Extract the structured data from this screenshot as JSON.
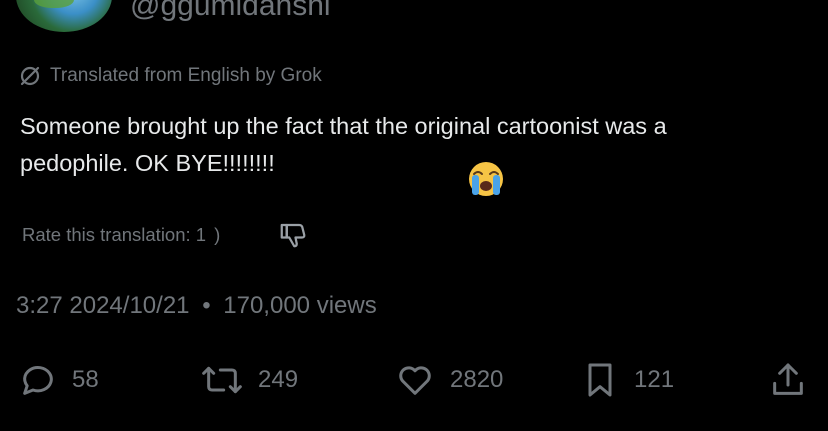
{
  "author": {
    "handle": "@ggumidanshi"
  },
  "translation": {
    "notice": "Translated from English by Grok",
    "rate_label": "Rate this translation: 1",
    "rate_suffix": ")"
  },
  "tweet": {
    "line1": "Someone brought up the fact that the original cartoonist was a",
    "line2": "pedophile. OK BYE!!!!!!!!",
    "emoji": "loudly-crying-face"
  },
  "meta": {
    "time": "3:27",
    "date": "2024/10/21",
    "separator": "•",
    "views": "170,000 views"
  },
  "actions": {
    "replies": "58",
    "reposts": "249",
    "likes": "2820",
    "bookmarks": "121"
  },
  "colors": {
    "background": "#000000",
    "text_primary": "#e7e9ea",
    "text_secondary": "#71767b"
  },
  "icons": [
    "grok-translate-icon",
    "thumbs-down-icon",
    "reply-icon",
    "repost-icon",
    "like-icon",
    "bookmark-icon",
    "share-icon"
  ]
}
